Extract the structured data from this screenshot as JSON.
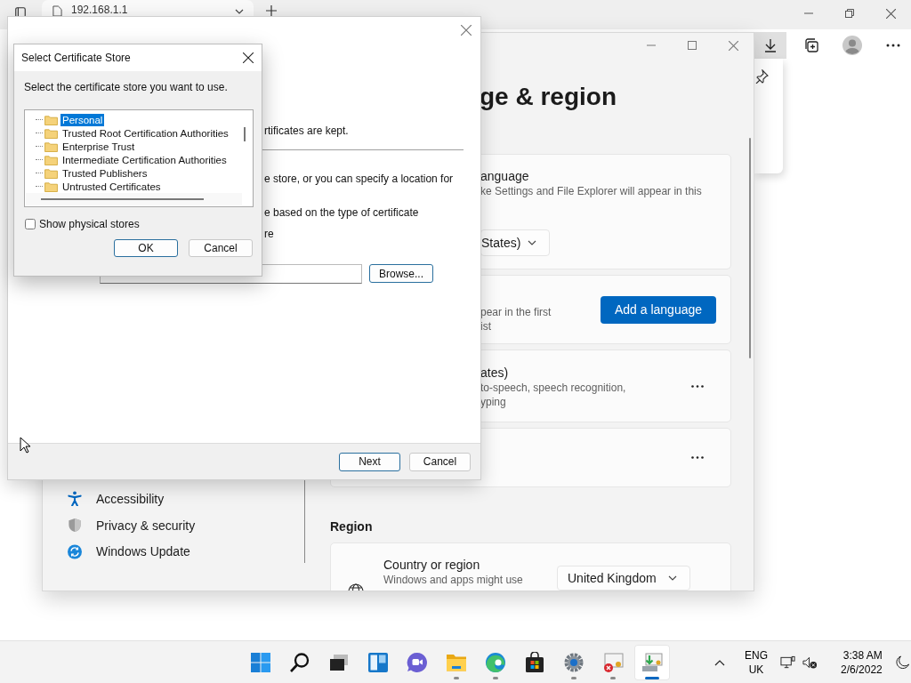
{
  "browser": {
    "tab_title": "192.168.1.1",
    "toolbar": [
      {
        "kind": "download",
        "selected": true
      },
      {
        "kind": "collections",
        "selected": false
      },
      {
        "kind": "profile",
        "selected": false
      },
      {
        "kind": "more",
        "selected": false
      }
    ]
  },
  "settings": {
    "heading": "ge & region",
    "cards": [
      {
        "kind": "dropdown",
        "title": "anguage",
        "description": [
          "ke Settings and File Explorer will appear in this"
        ],
        "value": "States)"
      },
      {
        "kind": "button",
        "description": [
          "pear in the first",
          "ist"
        ],
        "button": "Add a language"
      },
      {
        "kind": "more",
        "title": "ates)",
        "description": [
          "to-speech, speech recognition,",
          "yping"
        ]
      },
      {
        "kind": "more"
      }
    ],
    "sidebar": [
      {
        "kind": "accessibility",
        "label": "Accessibility"
      },
      {
        "kind": "privacy",
        "label": "Privacy & security"
      },
      {
        "kind": "update",
        "label": "Windows Update"
      }
    ],
    "region": {
      "heading": "Region",
      "title": "Country or region",
      "description": "Windows and apps might use",
      "value": "United Kingdom"
    }
  },
  "wizard": {
    "intro": "rtificates are kept.",
    "store_note": "e store, or you can specify a location for",
    "auto_option": "e based on the type of certificate",
    "place_option": "re",
    "browse_button": "Browse...",
    "buttons": [
      {
        "label": "Next",
        "default": true
      },
      {
        "label": "Cancel",
        "default": false
      }
    ]
  },
  "store_dialog": {
    "title": "Select Certificate Store",
    "instruction": "Select the certificate store you want to use.",
    "stores": [
      {
        "label": "Personal",
        "selected": true
      },
      {
        "label": "Trusted Root Certification Authorities",
        "selected": false
      },
      {
        "label": "Enterprise Trust",
        "selected": false
      },
      {
        "label": "Intermediate Certification Authorities",
        "selected": false
      },
      {
        "label": "Trusted Publishers",
        "selected": false
      },
      {
        "label": "Untrusted Certificates",
        "selected": false
      }
    ],
    "show_physical_stores": {
      "label": "Show physical stores",
      "checked": false
    },
    "buttons": [
      {
        "label": "OK",
        "default": true
      },
      {
        "label": "Cancel",
        "default": false
      }
    ]
  },
  "taskbar": {
    "apps": [
      {
        "kind": "start",
        "running": false,
        "selected": false
      },
      {
        "kind": "search",
        "running": false,
        "selected": false
      },
      {
        "kind": "taskview",
        "running": false,
        "selected": false
      },
      {
        "kind": "widgets",
        "running": false,
        "selected": false
      },
      {
        "kind": "chat",
        "running": false,
        "selected": false
      },
      {
        "kind": "explorer",
        "running": true,
        "selected": false
      },
      {
        "kind": "edge",
        "running": true,
        "selected": false
      },
      {
        "kind": "store",
        "running": false,
        "selected": false
      },
      {
        "kind": "settings",
        "running": true,
        "selected": false
      },
      {
        "kind": "certificate",
        "running": true,
        "selected": false
      },
      {
        "kind": "wizard",
        "running": true,
        "selected": true
      }
    ],
    "language": [
      "ENG",
      "UK"
    ],
    "time": "3:38 AM",
    "date": "2/6/2022"
  }
}
